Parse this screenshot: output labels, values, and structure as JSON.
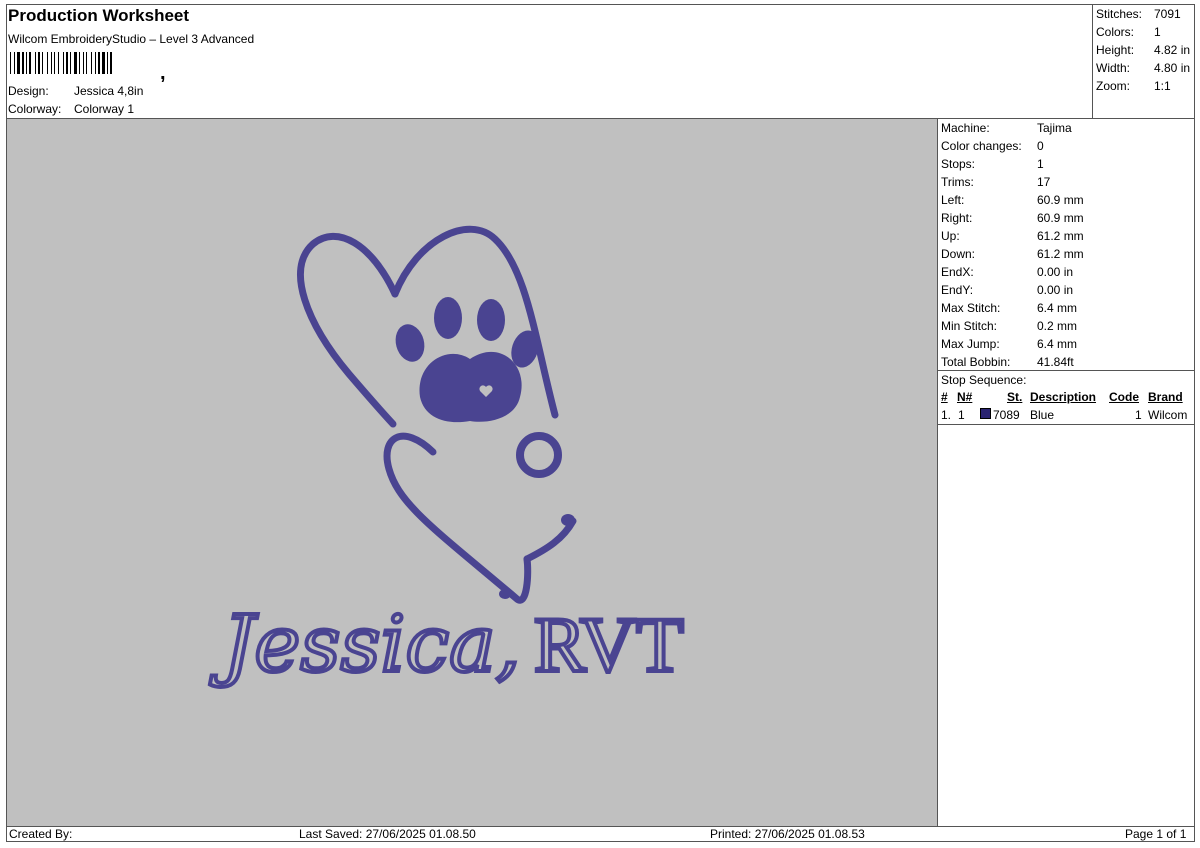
{
  "header": {
    "title": "Production Worksheet",
    "subtitle": "Wilcom EmbroideryStudio – Level 3 Advanced",
    "design_label": "Design:",
    "design_value": "Jessica 4,8in",
    "colorway_label": "Colorway:",
    "colorway_value": "Colorway 1"
  },
  "stats": [
    {
      "label": "Stitches:",
      "value": "7091"
    },
    {
      "label": "Colors:",
      "value": "1"
    },
    {
      "label": "Height:",
      "value": "4.82 in"
    },
    {
      "label": "Width:",
      "value": "4.80 in"
    },
    {
      "label": "Zoom:",
      "value": "1:1"
    }
  ],
  "details": [
    {
      "label": "Machine:",
      "value": "Tajima"
    },
    {
      "label": "Color changes:",
      "value": "0"
    },
    {
      "label": "Stops:",
      "value": "1"
    },
    {
      "label": "Trims:",
      "value": "17"
    },
    {
      "label": "Left:",
      "value": "60.9 mm"
    },
    {
      "label": "Right:",
      "value": "60.9 mm"
    },
    {
      "label": "Up:",
      "value": "61.2 mm"
    },
    {
      "label": "Down:",
      "value": "61.2 mm"
    },
    {
      "label": "EndX:",
      "value": "0.00 in"
    },
    {
      "label": "EndY:",
      "value": "0.00 in"
    },
    {
      "label": "Max Stitch:",
      "value": "6.4 mm"
    },
    {
      "label": "Min Stitch:",
      "value": "0.2 mm"
    },
    {
      "label": "Max Jump:",
      "value": "6.4 mm"
    },
    {
      "label": "Total Bobbin:",
      "value": "41.84ft"
    }
  ],
  "stop_sequence": {
    "title": "Stop Sequence:",
    "headers": {
      "hash": "#",
      "n": "N#",
      "st": "St.",
      "description": "Description",
      "code": "Code",
      "brand": "Brand"
    },
    "rows": [
      {
        "hash": "1.",
        "n": "1",
        "st": "7089",
        "description": "Blue",
        "code": "1",
        "brand": "Wilcom",
        "color": "#2a2371"
      }
    ]
  },
  "design": {
    "text_script": "Jessica,",
    "text_serif": "RVT",
    "thread_color": "#4a4491"
  },
  "footer": {
    "created_by": "Created By:",
    "last_saved": "Last Saved: 27/06/2025 01.08.50",
    "printed": "Printed: 27/06/2025 01.08.53",
    "page": "Page 1 of 1"
  }
}
